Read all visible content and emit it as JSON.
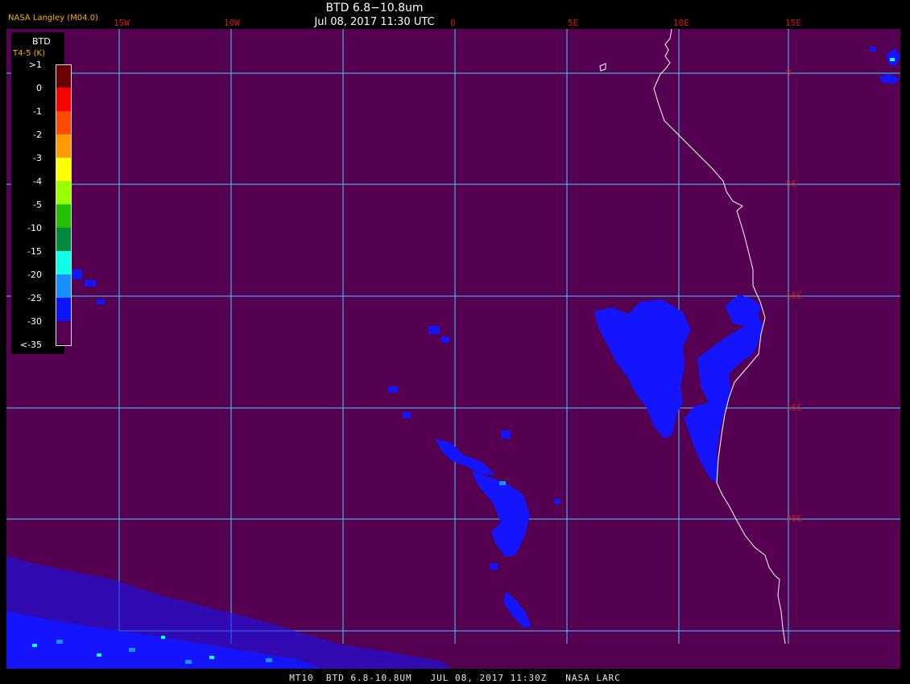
{
  "header": {
    "title": "BTD 6.8−10.8um",
    "datetime": "Jul 08, 2017 11:30 UTC",
    "agency": "NASA Langley (M04.0)"
  },
  "footer": {
    "text": "MT10  BTD 6.8-10.8UM   JUL 08, 2017 11:30Z   NASA LARC"
  },
  "legend": {
    "title": "BTD",
    "units": "T4-5 (K)",
    "bins": [
      {
        "label": ">1",
        "color": "#6a0000"
      },
      {
        "label": "0",
        "color": "#ff0000"
      },
      {
        "label": "-1",
        "color": "#ff4a00"
      },
      {
        "label": "-2",
        "color": "#ff9a00"
      },
      {
        "label": "-3",
        "color": "#ffff00"
      },
      {
        "label": "-4",
        "color": "#9aff00"
      },
      {
        "label": "-5",
        "color": "#22c000"
      },
      {
        "label": "-10",
        "color": "#008a40"
      },
      {
        "label": "-15",
        "color": "#10ffe8"
      },
      {
        "label": "-20",
        "color": "#1890ff"
      },
      {
        "label": "-25",
        "color": "#0a14ff"
      },
      {
        "label": "-30",
        "color": "#560052"
      }
    ],
    "min_label": "<-35"
  },
  "grid": {
    "longitudes": [
      "15W",
      "10W",
      "0",
      "5E",
      "10E",
      "15E"
    ],
    "latitudes": [
      "0",
      "5S",
      "10S",
      "15S",
      "20S"
    ]
  },
  "colors": {
    "background": "#560052",
    "grid": "#3fd0ff",
    "cloud": "#1414ff",
    "coast": "#ffffff",
    "labels": "#d01818"
  }
}
